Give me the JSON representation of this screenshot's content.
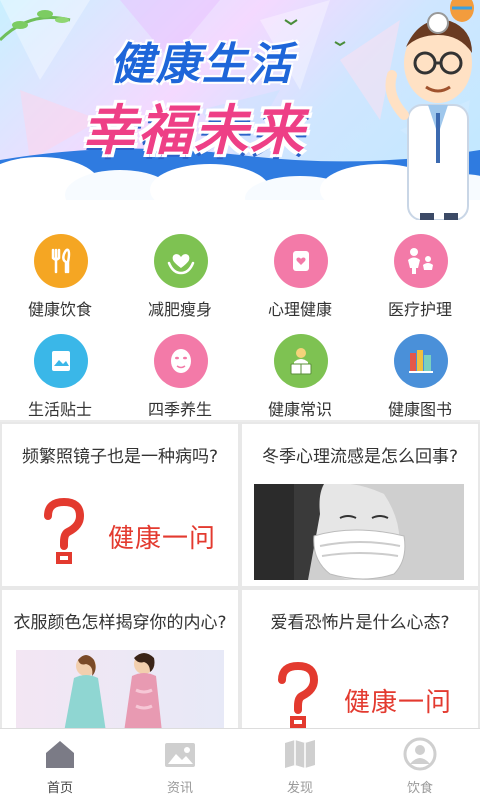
{
  "banner": {
    "line1": "健康生活",
    "line2_a": "幸福",
    "line2_b": "未来"
  },
  "categories": [
    {
      "label": "健康饮食",
      "icon": "fork-spoon-icon",
      "color": "#f5a623"
    },
    {
      "label": "减肥瘦身",
      "icon": "heart-hands-icon",
      "color": "#7ec252"
    },
    {
      "label": "心理健康",
      "icon": "heart-card-icon",
      "color": "#f37aa8"
    },
    {
      "label": "医疗护理",
      "icon": "family-icon",
      "color": "#f37aa8"
    },
    {
      "label": "生活贴士",
      "icon": "photo-card-icon",
      "color": "#3ab7e8"
    },
    {
      "label": "四季养生",
      "icon": "face-mask-icon",
      "color": "#f37aa8"
    },
    {
      "label": "健康常识",
      "icon": "reader-icon",
      "color": "#7ec252"
    },
    {
      "label": "健康图书",
      "icon": "books-icon",
      "color": "#4a90d9"
    }
  ],
  "articles": [
    {
      "title": "频繁照镜子也是一种病吗?",
      "tag": "健康一问"
    },
    {
      "title": "冬季心理流感是怎么回事?"
    },
    {
      "title": "衣服颜色怎样揭穿你的内心?"
    },
    {
      "title": "爱看恐怖片是什么心态?",
      "tag": "健康一问"
    }
  ],
  "tabs": [
    {
      "label": "首页",
      "icon": "home-icon",
      "active": true
    },
    {
      "label": "资讯",
      "icon": "image-icon",
      "active": false
    },
    {
      "label": "发现",
      "icon": "map-icon",
      "active": false
    },
    {
      "label": "饮食",
      "icon": "user-icon",
      "active": false
    }
  ],
  "colors": {
    "accent_red": "#e33a2f",
    "tab_inactive": "#999999"
  }
}
